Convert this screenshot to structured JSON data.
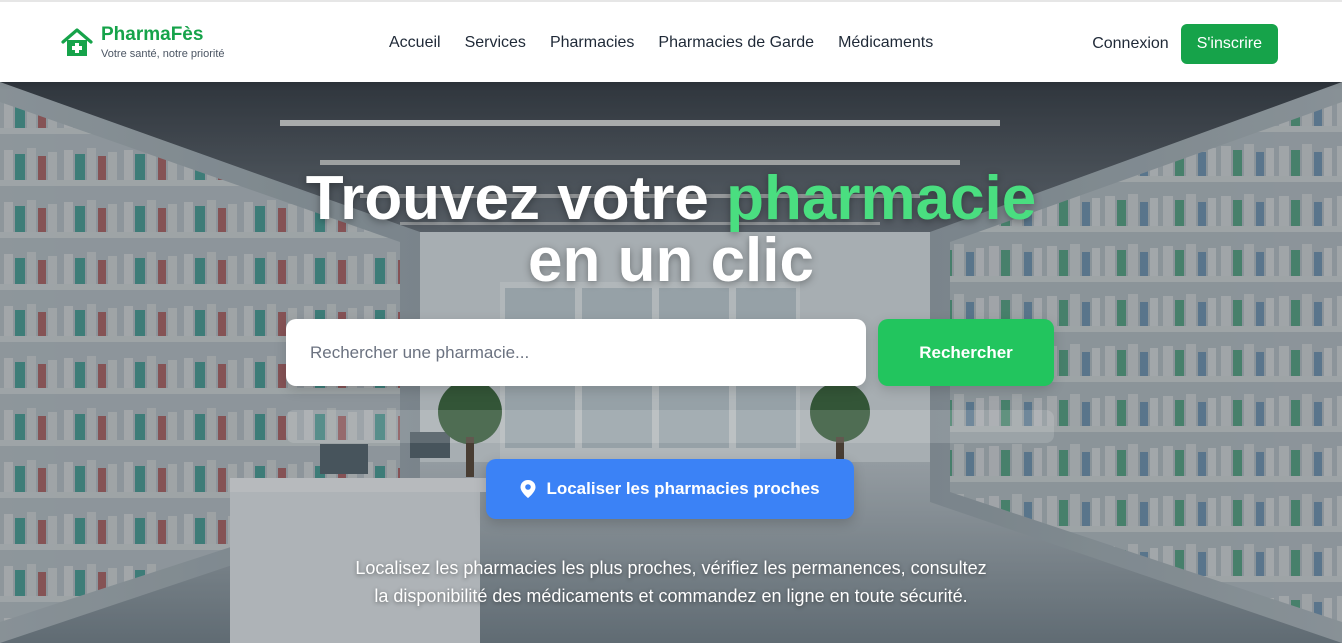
{
  "header": {
    "brand_name": "PharmaFès",
    "brand_tagline": "Votre santé, notre priorité",
    "brand_icon": "house-cross-icon",
    "brand_color": "#16a34a",
    "nav": [
      {
        "label": "Accueil"
      },
      {
        "label": "Services"
      },
      {
        "label": "Pharmacies"
      },
      {
        "label": "Pharmacies de Garde"
      },
      {
        "label": "Médicaments"
      }
    ],
    "login_label": "Connexion",
    "signup_label": "S'inscrire"
  },
  "hero": {
    "title_part1": "Trouvez votre",
    "title_accent": "pharmacie",
    "title_part2": "en un clic",
    "accent_color": "#4ade80",
    "search": {
      "placeholder": "Rechercher une pharmacie...",
      "value": "",
      "button_label": "Rechercher"
    },
    "locate_label": "Localiser les pharmacies proches",
    "locate_icon": "map-pin-icon",
    "description_line1": "Localisez les pharmacies les plus proches, vérifiez les permanences, consultez",
    "description_line2": "la disponibilité des médicaments et commandez en ligne en toute sécurité."
  }
}
